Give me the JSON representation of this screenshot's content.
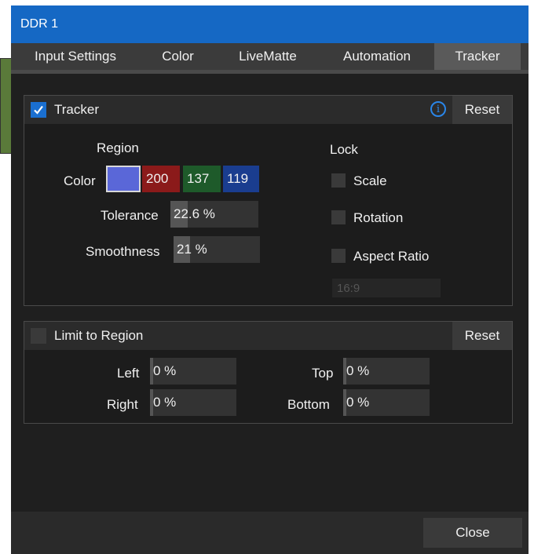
{
  "window": {
    "title": "DDR 1"
  },
  "tabs": [
    {
      "label": "Input Settings"
    },
    {
      "label": "Color"
    },
    {
      "label": "LiveMatte"
    },
    {
      "label": "Automation"
    },
    {
      "label": "Tracker",
      "active": true
    }
  ],
  "tracker": {
    "enabled": true,
    "title": "Tracker",
    "reset_label": "Reset",
    "region_heading": "Region",
    "color_label": "Color",
    "color": {
      "swatch": "#5a67d8",
      "r": "200",
      "g": "137",
      "b": "119"
    },
    "tolerance_label": "Tolerance",
    "tolerance_value": "22.6 %",
    "smoothness_label": "Smoothness",
    "smoothness_value": "21 %",
    "lock_heading": "Lock",
    "lock": [
      {
        "label": "Scale",
        "checked": false
      },
      {
        "label": "Rotation",
        "checked": false
      },
      {
        "label": "Aspect Ratio",
        "checked": false
      }
    ],
    "aspect_ratio_value": "16:9"
  },
  "limit": {
    "enabled": false,
    "title": "Limit to Region",
    "reset_label": "Reset",
    "left_label": "Left",
    "left_value": "0 %",
    "right_label": "Right",
    "right_value": "0 %",
    "top_label": "Top",
    "top_value": "0 %",
    "bottom_label": "Bottom",
    "bottom_value": "0 %"
  },
  "footer": {
    "close_label": "Close"
  },
  "colors": {
    "accent": "#1568c4",
    "red_channel": "#8b1a1a",
    "green_channel": "#1e5a2a",
    "blue_channel": "#1a3d8f"
  }
}
